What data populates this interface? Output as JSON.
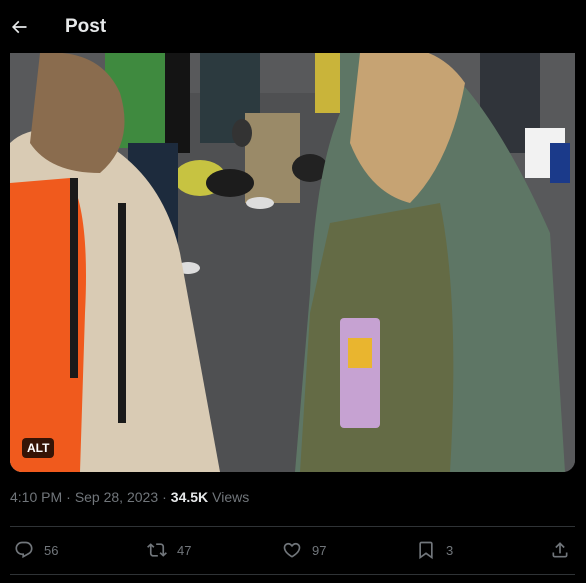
{
  "header": {
    "title": "Post",
    "back_icon": "arrow-left-icon"
  },
  "media": {
    "alt_label": "ALT"
  },
  "meta": {
    "time": "4:10 PM",
    "separator": "·",
    "date": "Sep 28, 2023",
    "views_count": "34.5K",
    "views_label": "Views"
  },
  "actions": {
    "replies": "56",
    "reposts": "47",
    "likes": "97",
    "bookmarks": "3"
  },
  "colors": {
    "background": "#000000",
    "text_primary": "#e7e9ea",
    "text_secondary": "#71767b",
    "divider": "#2f3336"
  }
}
